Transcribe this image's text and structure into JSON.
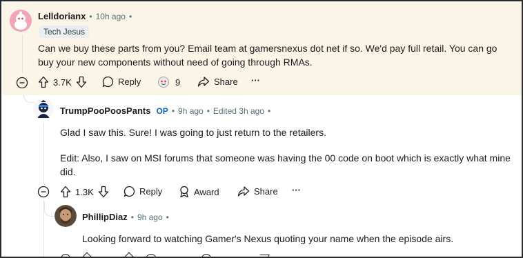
{
  "comments": [
    {
      "username": "Lelldorianx",
      "time": "10h ago",
      "flair": "Tech Jesus",
      "body": "Can we buy these parts from you? Email team at gamersnexus dot net if so. We'd pay full retail. You can go buy your new components without need of going through RMAs.",
      "votes": "3.7K",
      "reply_label": "Reply",
      "award_count": "9",
      "share_label": "Share",
      "more_label": "···",
      "accent": "#fbf5e8"
    },
    {
      "username": "TrumpPooPoosPants",
      "op_badge": "OP",
      "time": "9h ago",
      "edited": "Edited 3h ago",
      "body1": "Glad I saw this. Sure! I was going to just return to the retailers.",
      "body2": "Edit: Also, I saw on MSI forums that someone was having the 00 code on boot which is exactly what mine did.",
      "votes": "1.3K",
      "reply_label": "Reply",
      "award_label": "Award",
      "share_label": "Share",
      "more_label": "···"
    },
    {
      "username": "PhillipDiaz",
      "time": "9h ago",
      "body": "Looking forward to watching Gamer's Nexus quoting your name when the episode airs."
    }
  ],
  "separator": "•",
  "colors": {
    "op_blue": "#0a66c2",
    "meta_gray": "#576f76",
    "highlight": "#fbf5e8"
  }
}
